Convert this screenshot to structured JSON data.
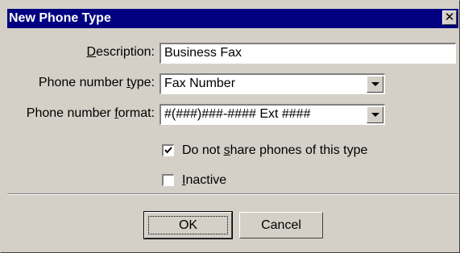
{
  "window": {
    "title": "New Phone Type",
    "close_glyph": "✕"
  },
  "form": {
    "description_label": {
      "before": "",
      "accel": "D",
      "after": "escription:"
    },
    "description_value": "Business Fax",
    "type_label": {
      "before": "Phone number ",
      "accel": "t",
      "after": "ype:"
    },
    "type_value": "Fax Number",
    "format_label": {
      "before": "Phone number ",
      "accel": "f",
      "after": "ormat:"
    },
    "format_value": "#(###)###-#### Ext ####"
  },
  "options": {
    "share_label": {
      "before": "Do not ",
      "accel": "s",
      "after": "hare phones of this type"
    },
    "share_checked": true,
    "inactive_label": {
      "before": "",
      "accel": "I",
      "after": "nactive"
    },
    "inactive_checked": false
  },
  "buttons": {
    "ok": "OK",
    "cancel": "Cancel"
  }
}
